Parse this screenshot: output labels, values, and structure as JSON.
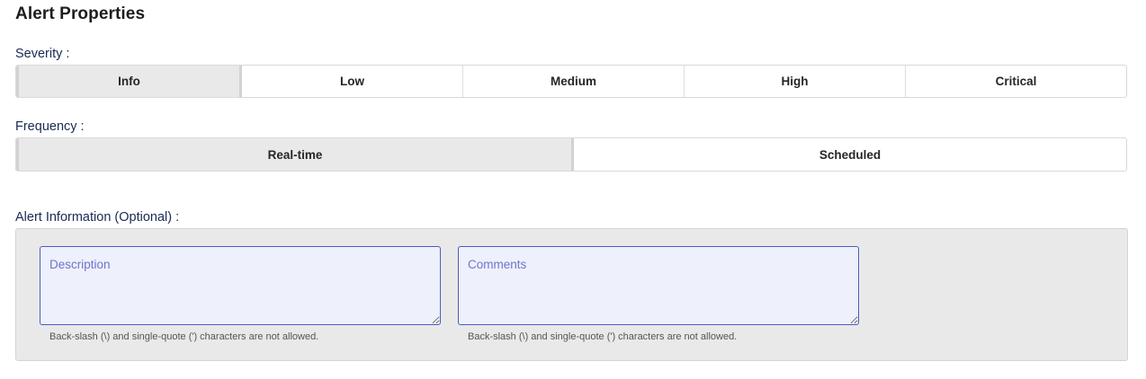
{
  "page": {
    "title": "Alert Properties"
  },
  "severity": {
    "label": "Severity :",
    "options": [
      "Info",
      "Low",
      "Medium",
      "High",
      "Critical"
    ],
    "selected": "Info"
  },
  "frequency": {
    "label": "Frequency :",
    "options": [
      "Real-time",
      "Scheduled"
    ],
    "selected": "Real-time"
  },
  "alert_information": {
    "label": "Alert Information (Optional) :",
    "description": {
      "placeholder": "Description",
      "value": "",
      "hint": "Back-slash (\\) and single-quote (') characters are not allowed."
    },
    "comments": {
      "placeholder": "Comments",
      "value": "",
      "hint": "Back-slash (\\) and single-quote (') characters are not allowed."
    }
  },
  "colors": {
    "label_text": "#1a2a55",
    "selected_segment": "#e9e9e9",
    "textarea_border": "#4a5bc4",
    "textarea_bg": "#eef0fb",
    "panel_bg": "#e9e9e9"
  }
}
